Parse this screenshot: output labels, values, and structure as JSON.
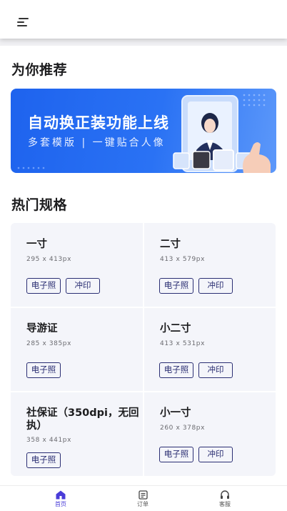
{
  "recommend": {
    "title": "为你推荐",
    "banner": {
      "title": "自动换正装功能上线",
      "subtitle": "多套模版 | 一键贴合人像"
    }
  },
  "hot": {
    "title": "热门规格",
    "items": [
      {
        "name": "一寸",
        "size": "295 x 413px",
        "tags": [
          "电子照",
          "冲印"
        ]
      },
      {
        "name": "二寸",
        "size": "413 x 579px",
        "tags": [
          "电子照",
          "冲印"
        ]
      },
      {
        "name": "导游证",
        "size": "285 x 385px",
        "tags": [
          "电子照"
        ]
      },
      {
        "name": "小二寸",
        "size": "413 x 531px",
        "tags": [
          "电子照",
          "冲印"
        ]
      },
      {
        "name": "社保证（350dpi，无回执）",
        "size": "358 x 441px",
        "tags": [
          "电子照"
        ]
      },
      {
        "name": "小一寸",
        "size": "260 x 378px",
        "tags": [
          "电子照",
          "冲印"
        ]
      }
    ]
  },
  "nav": {
    "items": [
      {
        "label": "首页",
        "icon": "home-icon",
        "active": true
      },
      {
        "label": "订单",
        "icon": "order-icon",
        "active": false
      },
      {
        "label": "客服",
        "icon": "headset-icon",
        "active": false
      }
    ]
  },
  "colors": {
    "accent": "#4a3cd8",
    "banner": "#2a6cf2",
    "tag": "#2b2f73"
  }
}
